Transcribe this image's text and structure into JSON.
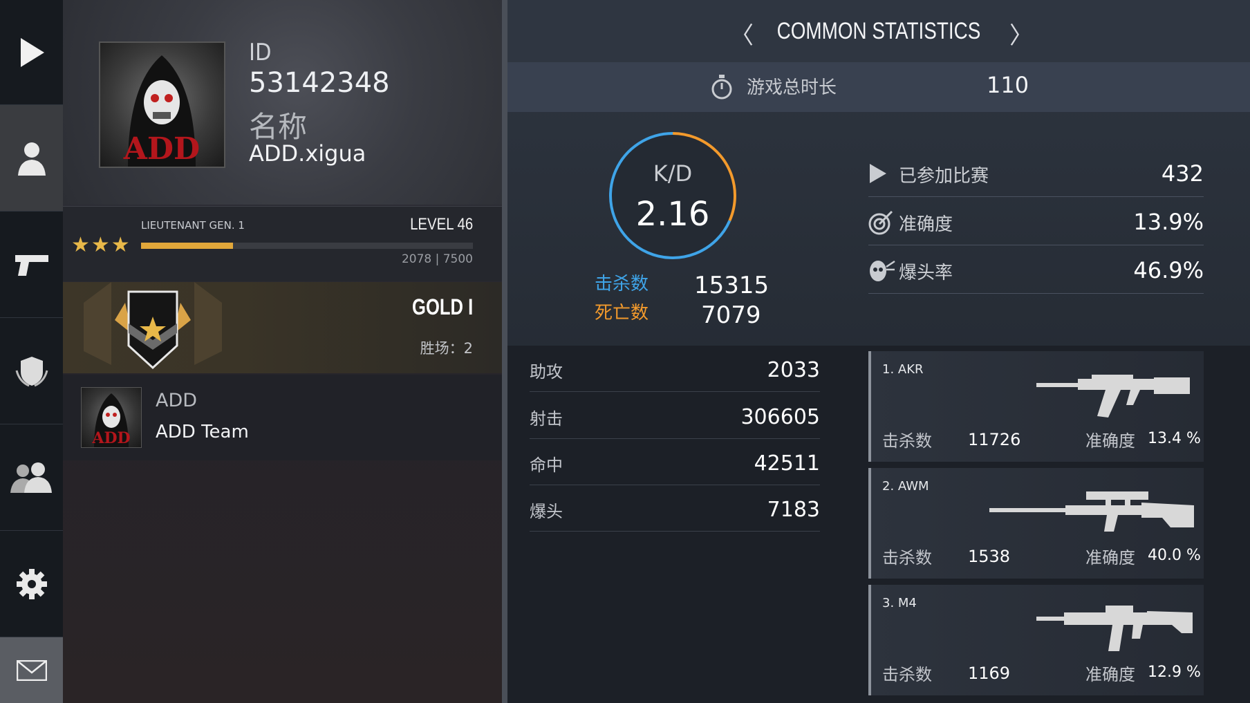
{
  "sidebar": {
    "items": [
      {
        "name": "play-icon",
        "active": false
      },
      {
        "name": "profile-icon",
        "active": true
      },
      {
        "name": "pistol-icon",
        "active": false
      },
      {
        "name": "clan-shield-icon",
        "active": false
      },
      {
        "name": "friends-icon",
        "active": false
      },
      {
        "name": "settings-icon",
        "active": false
      },
      {
        "name": "mail-icon",
        "active": true
      }
    ]
  },
  "profile": {
    "id_label": "ID",
    "id_value": "53142348",
    "name_label": "名称",
    "name_value": "ADD.xigua",
    "avatar_text": "ADD"
  },
  "rank": {
    "title": "LIEUTENANT GEN. 1",
    "level": "LEVEL 46",
    "xp": "2078 | 7500",
    "xp_current": 2078,
    "xp_max": 7500,
    "stars": "★★★"
  },
  "league": {
    "name": "GOLD I",
    "wins": "胜场：2"
  },
  "team": {
    "tag": "ADD",
    "name": "ADD Team"
  },
  "stats": {
    "header": "COMMON STATISTICS",
    "prev_arrow": "〈",
    "next_arrow": "〉",
    "time_label": "游戏总时长",
    "time_value": "110",
    "kd_label": "K/D",
    "kd_value": "2.16",
    "kd_ratio": 0.684,
    "kills_label": "击杀数",
    "kills_value": "15315",
    "deaths_label": "死亡数",
    "deaths_value": "7079",
    "summary": [
      {
        "icon": "play-icon",
        "label": "已参加比赛",
        "value": "432"
      },
      {
        "icon": "target-icon",
        "label": "准确度",
        "value": "13.9%"
      },
      {
        "icon": "headshot-icon",
        "label": "爆头率",
        "value": "46.9%"
      }
    ],
    "details": [
      {
        "label": "助攻",
        "value": "2033"
      },
      {
        "label": "射击",
        "value": "306605"
      },
      {
        "label": "命中",
        "value": "42511"
      },
      {
        "label": "爆头",
        "value": "7183"
      }
    ]
  },
  "weapons": [
    {
      "name": "1. AKR",
      "kills_label": "击杀数",
      "kills": "11726",
      "acc_label": "准确度",
      "acc": "13.4 %",
      "icon": "assault-rifle-icon"
    },
    {
      "name": "2. AWM",
      "kills_label": "击杀数",
      "kills": "1538",
      "acc_label": "准确度",
      "acc": "40.0 %",
      "icon": "sniper-rifle-icon"
    },
    {
      "name": "3. M4",
      "kills_label": "击杀数",
      "kills": "1169",
      "acc_label": "准确度",
      "acc": "12.9 %",
      "icon": "carbine-icon"
    }
  ],
  "colors": {
    "kills": "#3fa4e8",
    "deaths": "#f39a2c",
    "xp": "#e2a73a"
  }
}
